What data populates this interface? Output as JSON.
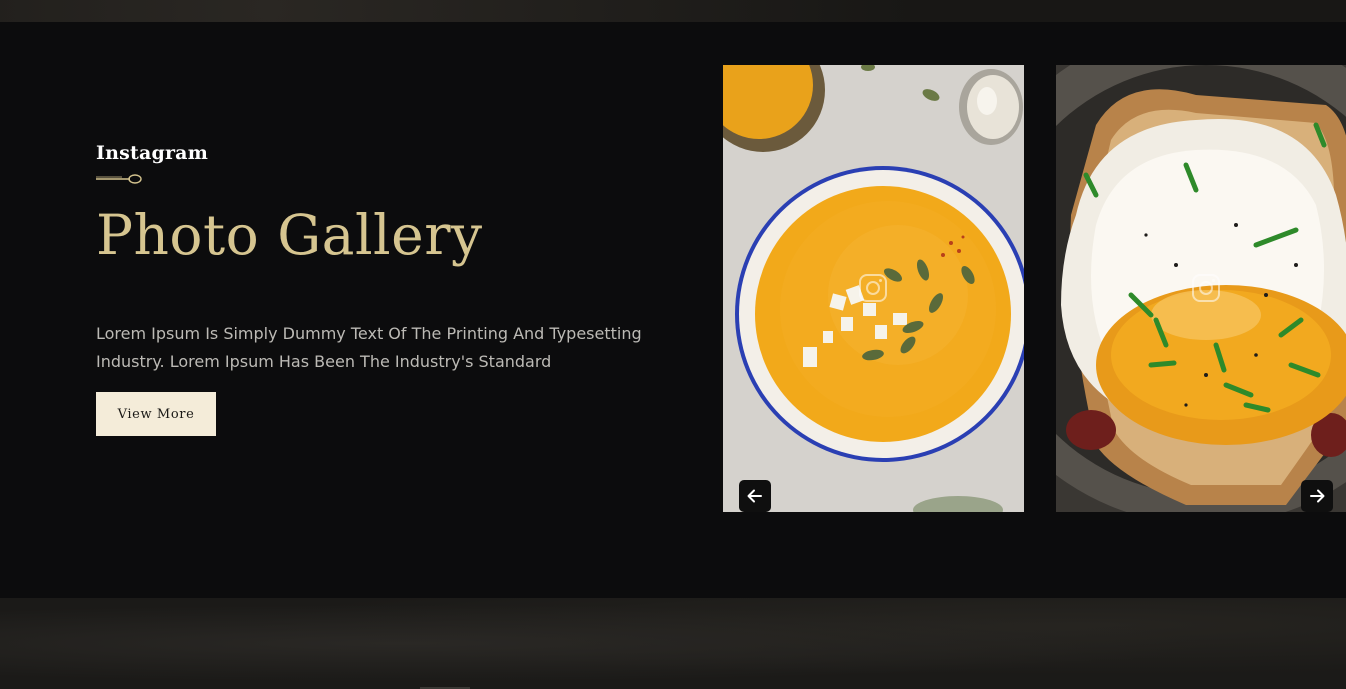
{
  "gallery": {
    "eyebrow": "Instagram",
    "title": "Photo Gallery",
    "description": "Lorem Ipsum Is Simply Dummy Text Of The Printing And Typesetting Industry. Lorem Ipsum Has Been The Industry's Standard",
    "cta_label": "View More"
  },
  "carousel": {
    "items": [
      {
        "icon": "instagram-icon",
        "image": "pumpkin-soup-photo"
      },
      {
        "icon": "instagram-icon",
        "image": "fried-egg-toast-photo"
      }
    ],
    "prev_icon": "arrow-left-icon",
    "next_icon": "arrow-right-icon"
  },
  "colors": {
    "section_bg": "#0c0c0d",
    "title_gold": "#d6c590",
    "button_bg": "#f4ecd9",
    "text_muted": "#bcbab5"
  }
}
